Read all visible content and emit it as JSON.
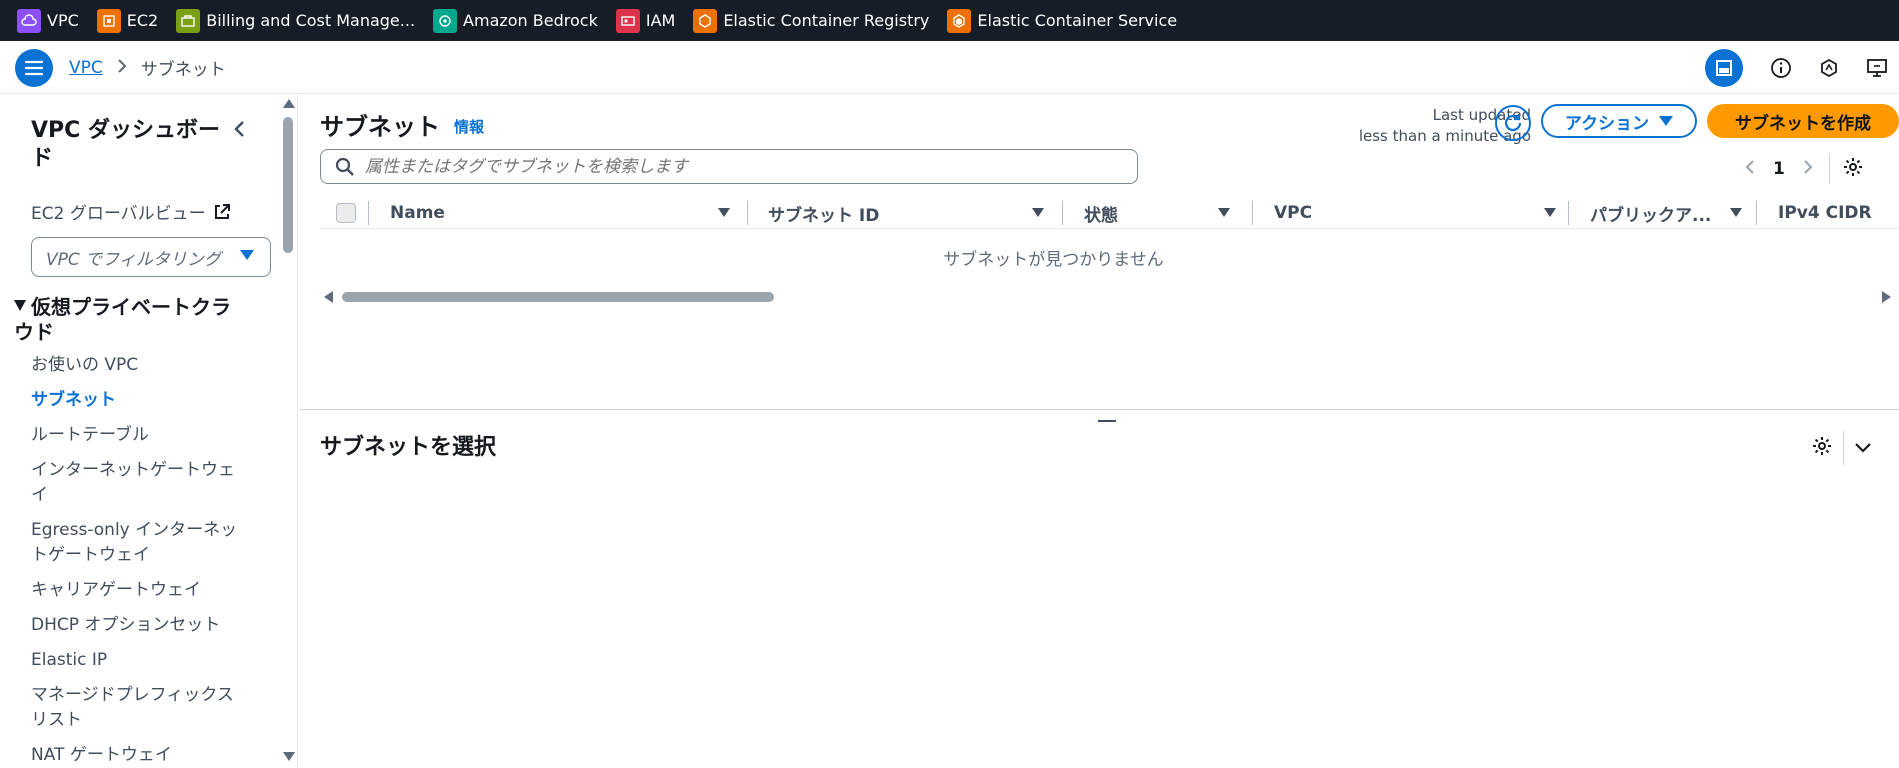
{
  "favorites": [
    {
      "label": "VPC",
      "icon": "vpc-icon",
      "color": "#8c4fff"
    },
    {
      "label": "EC2",
      "icon": "ec2-icon",
      "color": "#ed7100"
    },
    {
      "label": "Billing and Cost Manage...",
      "icon": "billing-icon",
      "color": "#7aa116"
    },
    {
      "label": "Amazon Bedrock",
      "icon": "bedrock-icon",
      "color": "#01a88d"
    },
    {
      "label": "IAM",
      "icon": "iam-icon",
      "color": "#dd344c"
    },
    {
      "label": "Elastic Container Registry",
      "icon": "ecr-icon",
      "color": "#ed7100"
    },
    {
      "label": "Elastic Container Service",
      "icon": "ecs-icon",
      "color": "#ed7100"
    }
  ],
  "breadcrumb": {
    "root": "VPC",
    "current": "サブネット"
  },
  "sidebar": {
    "title": "VPC ダッシュボード",
    "ec2_global": "EC2 グローバルビュー",
    "filter_placeholder": "VPC でフィルタリング",
    "section": "仮想プライベートクラウド",
    "items": [
      {
        "label": "お使いの VPC",
        "active": false
      },
      {
        "label": "サブネット",
        "active": true
      },
      {
        "label": "ルートテーブル",
        "active": false
      },
      {
        "label": "インターネットゲートウェイ",
        "active": false
      },
      {
        "label": "Egress-only インターネットゲートウェイ",
        "active": false
      },
      {
        "label": "キャリアゲートウェイ",
        "active": false
      },
      {
        "label": "DHCP オプションセット",
        "active": false
      },
      {
        "label": "Elastic IP",
        "active": false
      },
      {
        "label": "マネージドプレフィックスリスト",
        "active": false
      },
      {
        "label": "NAT ゲートウェイ",
        "active": false
      }
    ]
  },
  "main": {
    "title": "サブネット",
    "info": "情報",
    "last_updated_line1": "Last updated",
    "last_updated_line2": "less than a minute ago",
    "actions": "アクション",
    "create": "サブネットを作成",
    "search_placeholder": "属性またはタグでサブネットを検索します",
    "page": "1",
    "columns": [
      "Name",
      "サブネット ID",
      "状態",
      "VPC",
      "パブリックア...",
      "IPv4 CIDR"
    ],
    "empty": "サブネットが見つかりません"
  },
  "bottom_panel": {
    "title": "サブネットを選択"
  },
  "colors": {
    "accent": "#0972d3",
    "primary_button": "#ff9900",
    "topbar": "#161d26"
  }
}
